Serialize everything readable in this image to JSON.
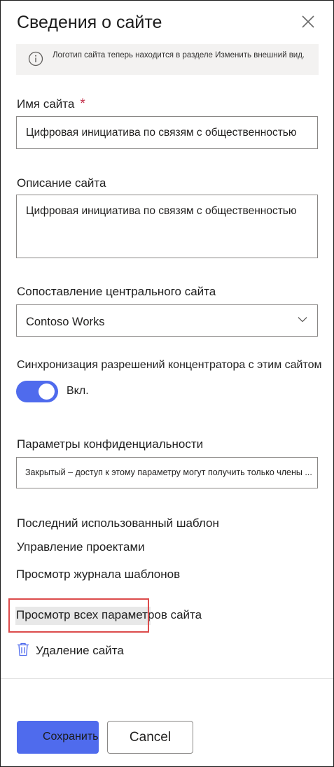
{
  "panel": {
    "title": "Сведения о сайте",
    "close_icon": "close-icon"
  },
  "info_bar": {
    "icon": "info-icon",
    "text": "Логотип сайта теперь находится в разделе Изменить внешний вид."
  },
  "site_name": {
    "label": "Имя сайта",
    "required_mark": "*",
    "value": "Цифровая инициатива по связям с общественностью"
  },
  "description": {
    "label": "Описание сайта",
    "value": "Цифровая инициатива по связям с общественностью"
  },
  "hub_association": {
    "label": "Сопоставление центрального сайта",
    "selected": "Contoso Works",
    "icon": "chevron-down-icon"
  },
  "hub_sync": {
    "label": "Синхронизация разрешений концентратора с этим сайтом",
    "toggle_label": "Вкл.",
    "on": true
  },
  "privacy": {
    "label": "Параметры конфиденциальности",
    "selected": "Закрытый – доступ к этому параметру могут получить только члены ..."
  },
  "template": {
    "heading": "Последний использованный шаблон",
    "name": "Управление проектами",
    "history_link": "Просмотр журнала шаблонов"
  },
  "links": {
    "all_settings": "Просмотр всех параметров сайта",
    "delete_site": "Удаление сайта",
    "delete_icon": "trash-icon"
  },
  "footer": {
    "save_label": "Сохранить",
    "cancel_label": "Cancel"
  },
  "colors": {
    "accent": "#4f6bed",
    "highlight_border": "#dc4b4b",
    "required": "#c4314b"
  }
}
